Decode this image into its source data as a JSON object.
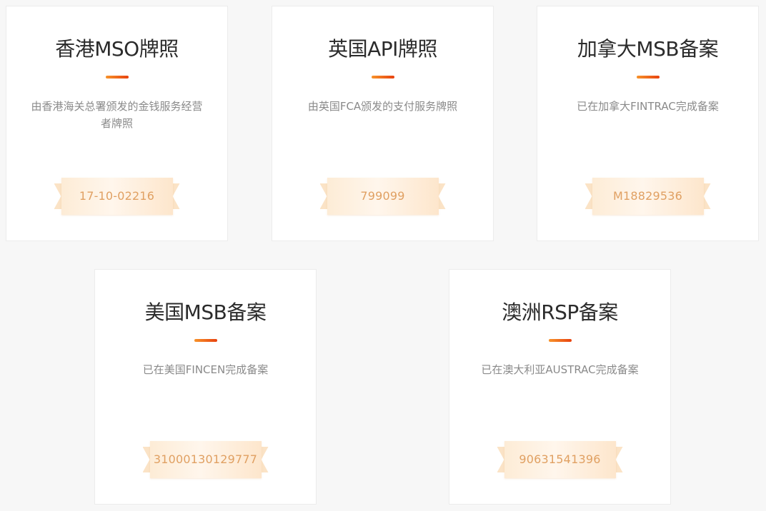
{
  "colors": {
    "accent_start": "#f7932a",
    "accent_end": "#e8420f",
    "title": "#2b2b2b",
    "description": "#8a8a8a",
    "badge_text": "#e0a062",
    "background": "#f7f7f7"
  },
  "licenses": [
    {
      "title": "香港MSO牌照",
      "description": "由香港海关总署颁发的金钱服务经营者牌照",
      "number": "17-10-02216"
    },
    {
      "title": "英国API牌照",
      "description": "由英国FCA颁发的支付服务牌照",
      "number": "799099"
    },
    {
      "title": "加拿大MSB备案",
      "description": "已在加拿大FINTRAC完成备案",
      "number": "M18829536"
    },
    {
      "title": "美国MSB备案",
      "description": "已在美国FINCEN完成备案",
      "number": "31000130129777"
    },
    {
      "title": "澳洲RSP备案",
      "description": "已在澳大利亚AUSTRAC完成备案",
      "number": "90631541396"
    }
  ]
}
